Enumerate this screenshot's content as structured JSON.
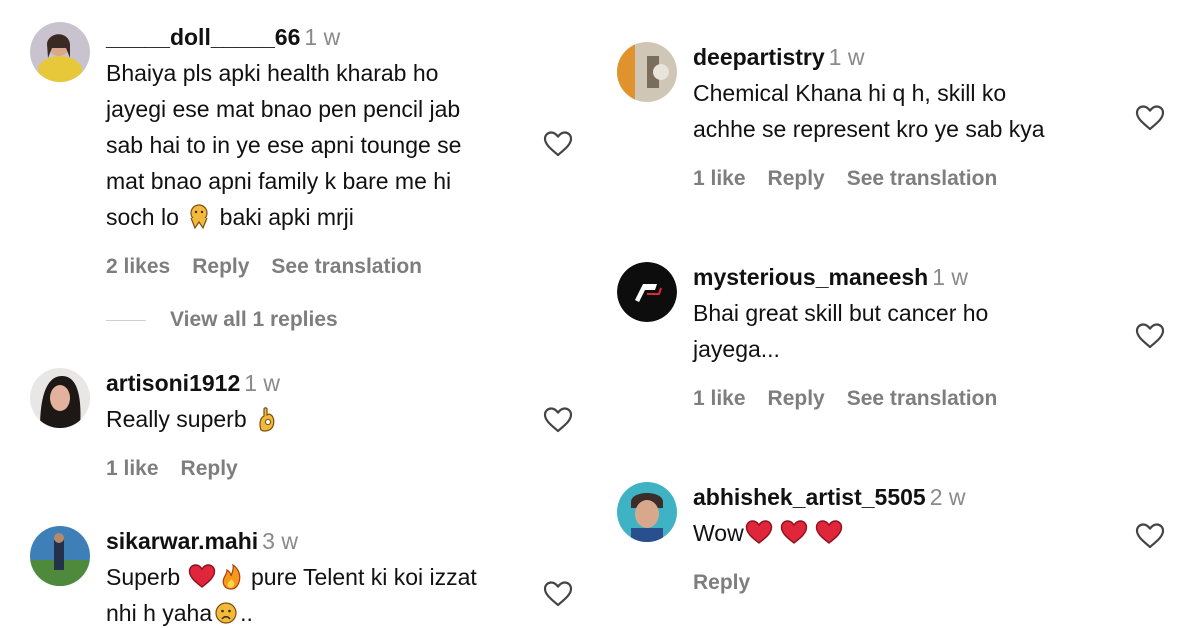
{
  "left": [
    {
      "username": "_____doll_____66",
      "time": "1 w",
      "lines": [
        "Bhaiya pls apki health kharab ho",
        "jayegi ese mat bnao pen pencil jab",
        "sab hai to in ye ese apni tounge se",
        "mat bnao apni family k bare me hi"
      ],
      "last_line_after_emoji": "baki apki mrji",
      "last_line_before_emoji": "soch lo",
      "likes": "2 likes",
      "reply": "Reply",
      "translate": "See translation",
      "view_replies": "View all 1 replies"
    },
    {
      "username": "artisoni1912",
      "time": "1 w",
      "text": "Really superb",
      "likes": "1 like",
      "reply": "Reply"
    },
    {
      "username": "sikarwar.mahi",
      "time": "3 w",
      "text_a": "Superb",
      "text_b": "pure Telent ki koi izzat",
      "text_c": "nhi h yaha",
      "text_d": ".."
    }
  ],
  "right": [
    {
      "username": "deepartistry",
      "time": "1 w",
      "lines": [
        "Chemical Khana hi q h, skill ko",
        "achhe se represent kro ye sab kya"
      ],
      "likes": "1 like",
      "reply": "Reply",
      "translate": "See translation"
    },
    {
      "username": "mysterious_maneesh",
      "time": "1 w",
      "lines": [
        "Bhai great skill but cancer ho",
        "jayega..."
      ],
      "likes": "1 like",
      "reply": "Reply",
      "translate": "See translation"
    },
    {
      "username": "abhishek_artist_5505",
      "time": "2 w",
      "text": "Wow",
      "reply": "Reply"
    }
  ],
  "colors": {
    "heart_red": "#e0263a",
    "muted": "#7e7e7e"
  },
  "icons": [
    "heart-outline-icon",
    "red-heart-emoji",
    "fire-emoji",
    "ok-hand-emoji",
    "praying-emoji",
    "sad-face-emoji"
  ]
}
